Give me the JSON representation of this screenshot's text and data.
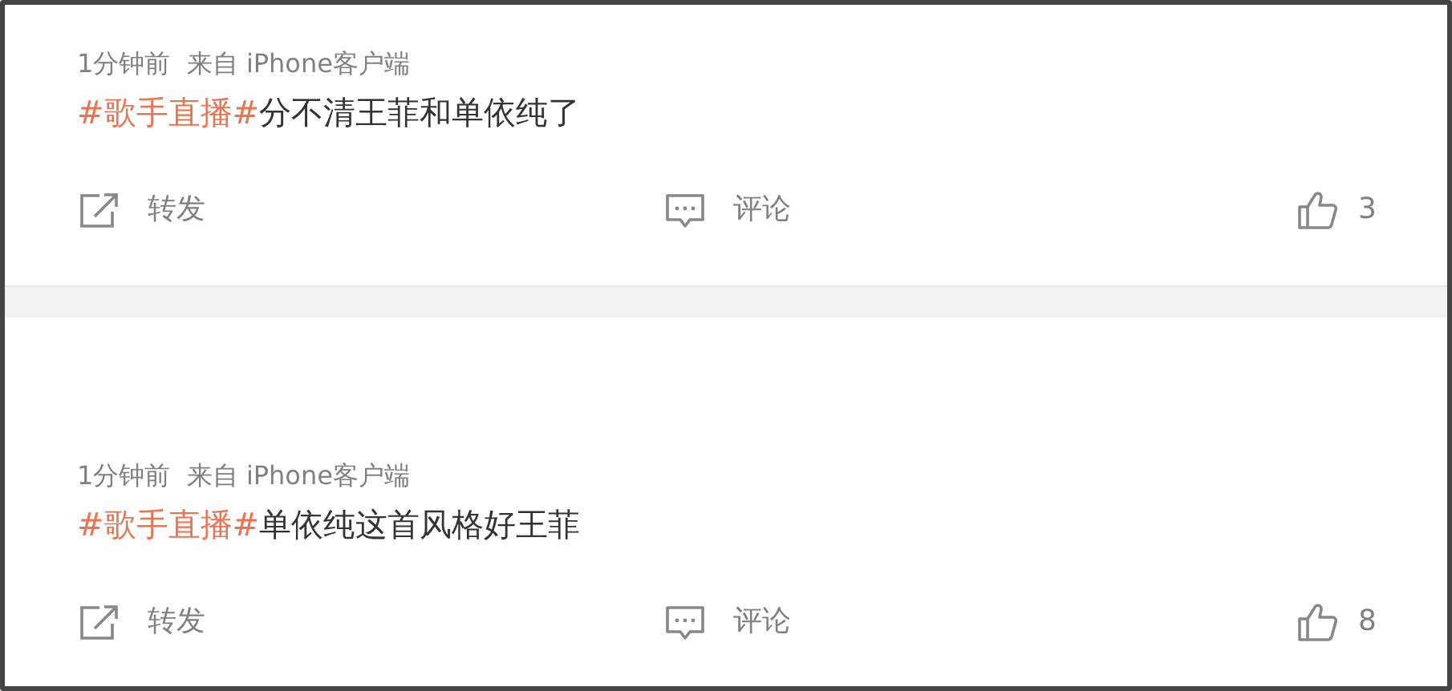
{
  "posts": [
    {
      "meta": "1分钟前  来自 iPhone客户端",
      "topic": "#歌手直播#",
      "text": "分不清王菲和单依纯了",
      "actions": {
        "repost": "转发",
        "comment": "评论",
        "likes": "3"
      }
    },
    {
      "meta": "1分钟前  来自 iPhone客户端",
      "topic": "#歌手直播#",
      "text": "单依纯这首风格好王菲",
      "actions": {
        "repost": "转发",
        "comment": "评论",
        "likes": "8"
      }
    }
  ]
}
